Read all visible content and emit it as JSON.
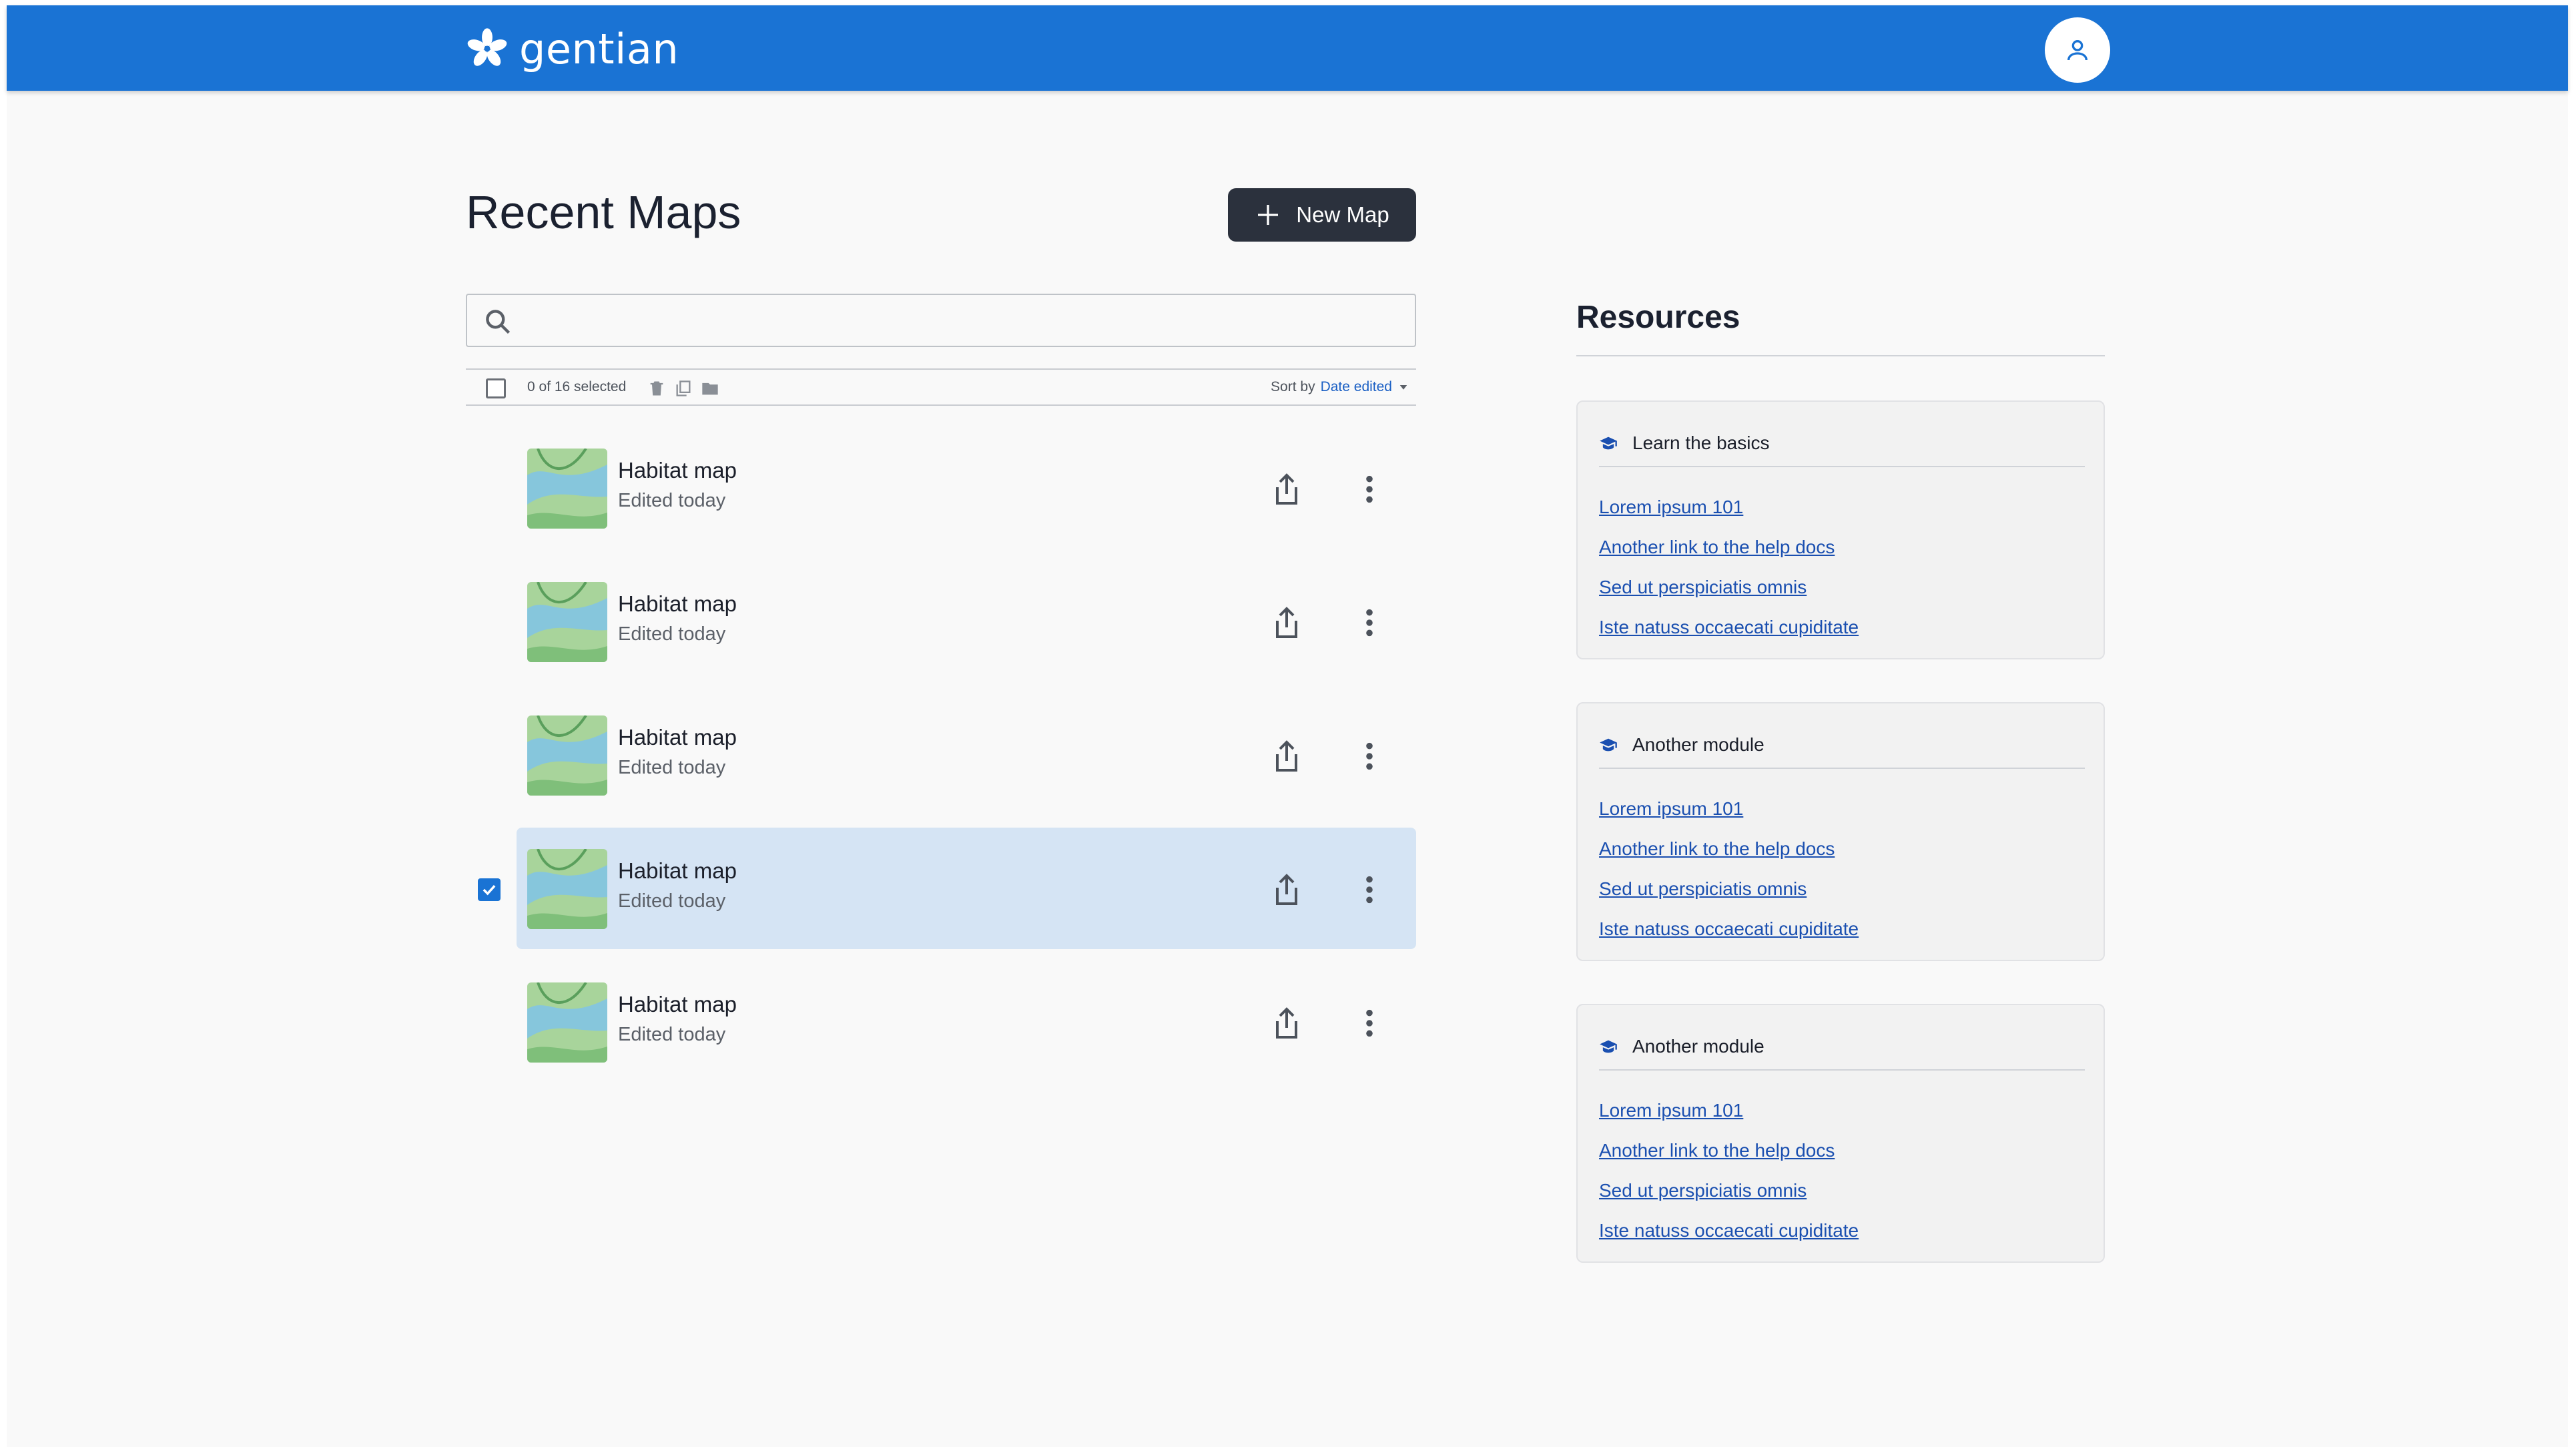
{
  "app": {
    "brand_name": "gentian",
    "brand_color": "#1a73d4"
  },
  "header": {
    "avatar_icon": "user-icon"
  },
  "main": {
    "title": "Recent Maps",
    "new_map_label": "New Map",
    "search": {
      "value": "",
      "placeholder": ""
    },
    "toolbar": {
      "selection_count": "0 of 16 selected",
      "sort_label": "Sort by",
      "sort_value": "Date edited",
      "icons": [
        "trash-icon",
        "copy-icon",
        "folder-icon"
      ]
    },
    "maps": [
      {
        "title": "Habitat map",
        "subtitle": "Edited today",
        "selected": false
      },
      {
        "title": "Habitat map",
        "subtitle": "Edited today",
        "selected": false
      },
      {
        "title": "Habitat map",
        "subtitle": "Edited today",
        "selected": false
      },
      {
        "title": "Habitat map",
        "subtitle": "Edited today",
        "selected": true
      },
      {
        "title": "Habitat map",
        "subtitle": "Edited today",
        "selected": false
      }
    ]
  },
  "resources": {
    "title": "Resources",
    "modules": [
      {
        "title": "Learn the basics",
        "links": [
          "Lorem ipsum 101",
          "Another link to the help docs",
          "Sed ut perspiciatis  omnis",
          "Iste natuss occaecati cupiditate"
        ]
      },
      {
        "title": "Another module",
        "links": [
          "Lorem ipsum 101",
          "Another link to the help docs",
          "Sed ut perspiciatis  omnis",
          "Iste natuss occaecati cupiditate"
        ]
      },
      {
        "title": "Another module",
        "links": [
          "Lorem ipsum 101",
          "Another link to the help docs",
          "Sed ut perspiciatis  omnis",
          "Iste natuss occaecati cupiditate"
        ]
      }
    ]
  }
}
